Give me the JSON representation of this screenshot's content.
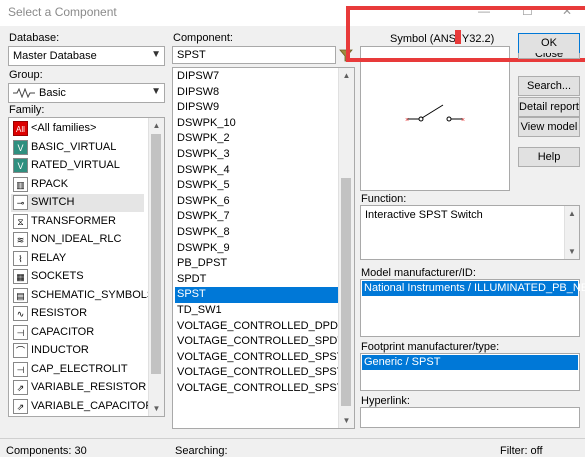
{
  "window": {
    "title": "Select a Component",
    "minimize": "—",
    "maximize": "☐",
    "close": "✕"
  },
  "database": {
    "label": "Database:",
    "value": "Master Database"
  },
  "group": {
    "label": "Group:",
    "value": "Basic",
    "icon": "resistor-icon"
  },
  "family": {
    "label": "Family:",
    "items": [
      {
        "label": "<All families>",
        "icon": "All"
      },
      {
        "label": "BASIC_VIRTUAL",
        "icon": "V"
      },
      {
        "label": "RATED_VIRTUAL",
        "icon": "V"
      },
      {
        "label": "RPACK",
        "icon": "▥"
      },
      {
        "label": "SWITCH",
        "icon": "⊸"
      },
      {
        "label": "TRANSFORMER",
        "icon": "⧖"
      },
      {
        "label": "NON_IDEAL_RLC",
        "icon": "≋"
      },
      {
        "label": "RELAY",
        "icon": "⌇"
      },
      {
        "label": "SOCKETS",
        "icon": "▦"
      },
      {
        "label": "SCHEMATIC_SYMBOLS",
        "icon": "▤"
      },
      {
        "label": "RESISTOR",
        "icon": "∿"
      },
      {
        "label": "CAPACITOR",
        "icon": "⊣"
      },
      {
        "label": "INDUCTOR",
        "icon": "⌒"
      },
      {
        "label": "CAP_ELECTROLIT",
        "icon": "⊣"
      },
      {
        "label": "VARIABLE_RESISTOR",
        "icon": "⇗"
      },
      {
        "label": "VARIABLE_CAPACITOR",
        "icon": "⇗"
      }
    ],
    "selected_index": 4
  },
  "component": {
    "label": "Component:",
    "value": "SPST",
    "items": [
      "DIPSW7",
      "DIPSW8",
      "DIPSW9",
      "DSWPK_10",
      "DSWPK_2",
      "DSWPK_3",
      "DSWPK_4",
      "DSWPK_5",
      "DSWPK_6",
      "DSWPK_7",
      "DSWPK_8",
      "DSWPK_9",
      "PB_DPST",
      "SPDT",
      "SPST",
      "TD_SW1",
      "VOLTAGE_CONTROLLED_DPDT",
      "VOLTAGE_CONTROLLED_SPDT",
      "VOLTAGE_CONTROLLED_SPST",
      "VOLTAGE_CONTROLLED_SPST_ANIMA",
      "VOLTAGE_CONTROLLED_SPST_BOUNC"
    ],
    "selected_index": 14
  },
  "symbol": {
    "label": "Symbol (ANSI Y32.2)"
  },
  "buttons": {
    "ok": "OK",
    "close": "Close",
    "search": "Search...",
    "detail": "Detail report",
    "view_model": "View model",
    "help": "Help"
  },
  "function": {
    "label": "Function:",
    "value": "Interactive SPST Switch"
  },
  "model": {
    "label": "Model manufacturer/ID:",
    "value": "National Instruments / ILLUMINATED_PB_NEW"
  },
  "footprint": {
    "label": "Footprint manufacturer/type:",
    "value": "Generic / SPST"
  },
  "hyperlink": {
    "label": "Hyperlink:"
  },
  "status": {
    "components": "Components: 30",
    "searching": "Searching:",
    "filter": "Filter: off"
  },
  "colors": {
    "selection": "#0078d7",
    "annotation": "#e83a3a"
  }
}
